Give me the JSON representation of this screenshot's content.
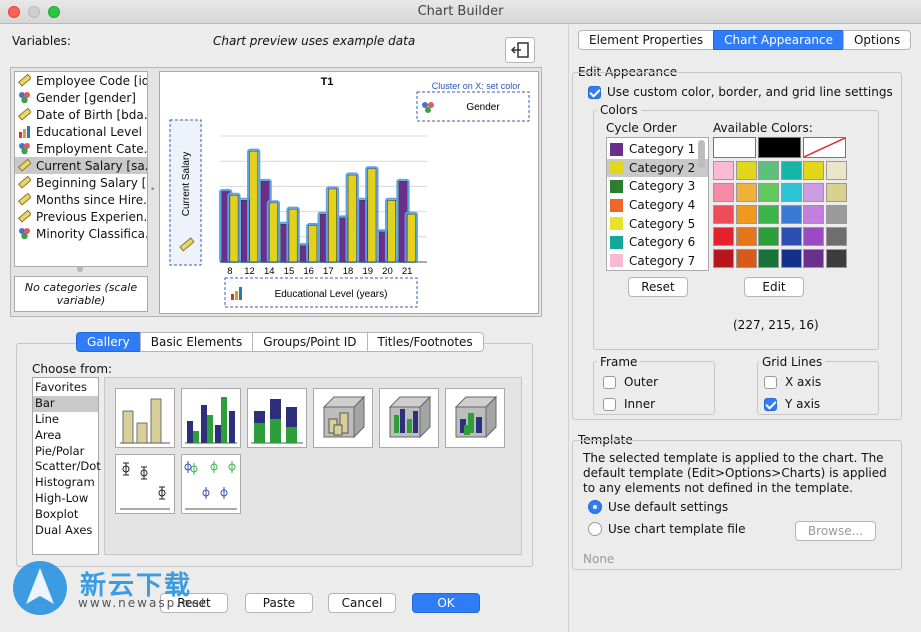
{
  "window": {
    "title": "Chart Builder"
  },
  "left": {
    "variables_label": "Variables:",
    "preview_note": "Chart preview uses example data",
    "variables": [
      {
        "label": "Employee Code [id]",
        "icon": "scale-ruler-icon"
      },
      {
        "label": "Gender [gender]",
        "icon": "nominal-icon"
      },
      {
        "label": "Date of Birth [bda...",
        "icon": "scale-ruler-icon"
      },
      {
        "label": "Educational Level ...",
        "icon": "ordinal-bars-icon"
      },
      {
        "label": "Employment Cate...",
        "icon": "nominal-icon"
      },
      {
        "label": "Current Salary [sa...",
        "icon": "scale-ruler-icon",
        "selected": true
      },
      {
        "label": "Beginning Salary [...",
        "icon": "scale-ruler-icon"
      },
      {
        "label": "Months since Hire...",
        "icon": "scale-ruler-icon"
      },
      {
        "label": "Previous Experien...",
        "icon": "scale-ruler-icon"
      },
      {
        "label": "Minority Classifica...",
        "icon": "nominal-icon"
      }
    ],
    "no_categories": "No categories (scale variable)",
    "tabs": [
      "Gallery",
      "Basic Elements",
      "Groups/Point ID",
      "Titles/Footnotes"
    ],
    "choose_from_label": "Choose from:",
    "gallery_types": [
      "Favorites",
      "Bar",
      "Line",
      "Area",
      "Pie/Polar",
      "Scatter/Dot",
      "Histogram",
      "High-Low",
      "Boxplot",
      "Dual Axes"
    ],
    "gallery_selected": "Bar",
    "buttons": {
      "reset": "Reset",
      "paste": "Paste",
      "cancel": "Cancel",
      "ok": "OK"
    },
    "watermark": {
      "brand": "新云下载",
      "url": "www.newasp.net"
    }
  },
  "preview": {
    "title": "T1",
    "cluster_label": "Cluster on X: set color",
    "cluster_var": "Gender",
    "y_axis": "Current Salary",
    "x_axis": "Educational Level (years)"
  },
  "chart_data": {
    "type": "bar",
    "title": "T1",
    "xlabel": "Educational Level (years)",
    "ylabel": "Current Salary",
    "categories": [
      "8",
      "12",
      "14",
      "15",
      "16",
      "17",
      "18",
      "19",
      "20",
      "21"
    ],
    "series": [
      {
        "color": "#6a2f8a",
        "values": [
          56,
          49,
          64,
          30,
          13,
          38,
          35,
          49,
          24,
          64
        ]
      },
      {
        "color": "#e3d21c",
        "values": [
          53,
          88,
          47,
          42,
          29,
          58,
          69,
          74,
          49,
          38
        ]
      }
    ],
    "ylim": [
      0,
      100
    ],
    "grid": true
  },
  "right": {
    "tabs": [
      "Element Properties",
      "Chart Appearance",
      "Options"
    ],
    "active_tab": "Chart Appearance",
    "edit_appearance_label": "Edit Appearance",
    "custom_check_label": "Use custom color, border, and grid line settings",
    "colors_label": "Colors",
    "cycle_order_label": "Cycle Order",
    "available_colors_label": "Available Colors:",
    "categories": [
      {
        "label": "Category 1",
        "color": "#6a2f8a"
      },
      {
        "label": "Category 2",
        "color": "#e3d71c",
        "selected": true
      },
      {
        "label": "Category 3",
        "color": "#2e7d32"
      },
      {
        "label": "Category 4",
        "color": "#f0652a"
      },
      {
        "label": "Category 5",
        "color": "#e9e22a"
      },
      {
        "label": "Category 6",
        "color": "#15a898"
      },
      {
        "label": "Category 7",
        "color": "#f7b9d4"
      }
    ],
    "palette_top": [
      "#ffffff",
      "#000000",
      "none"
    ],
    "palette": [
      [
        "#f7bcd4",
        "#e3d71c",
        "#5ec17a",
        "#15b5a8",
        "#e3d71c",
        "#ece6c8"
      ],
      [
        "#f48aa8",
        "#f0b23a",
        "#5fc95a",
        "#2ec4d6",
        "#cc9de0",
        "#d9d28e"
      ],
      [
        "#ee4c58",
        "#ef9a1e",
        "#39b54a",
        "#3b79d6",
        "#c27fdd",
        "#9a9a9a"
      ],
      [
        "#e3222e",
        "#e5761a",
        "#2e9e3a",
        "#2b4fb0",
        "#9a4bc2",
        "#6e6e6e"
      ],
      [
        "#b8161c",
        "#d9591a",
        "#16733a",
        "#14308a",
        "#6a2f8a",
        "#3c3c3c"
      ]
    ],
    "reset_label": "Reset",
    "edit_label": "Edit",
    "rgb_readout": "(227, 215, 16)",
    "frame_label": "Frame",
    "outer_label": "Outer",
    "inner_label": "Inner",
    "gridlines_label": "Grid Lines",
    "xaxis_label": "X axis",
    "yaxis_label": "Y axis",
    "template_label": "Template",
    "template_desc": "The selected template is applied to the chart. The default template (Edit>Options>Charts) is applied to any elements not defined in the template.",
    "use_default_label": "Use default settings",
    "use_file_label": "Use chart template file",
    "browse_label": "Browse...",
    "none_label": "None"
  }
}
